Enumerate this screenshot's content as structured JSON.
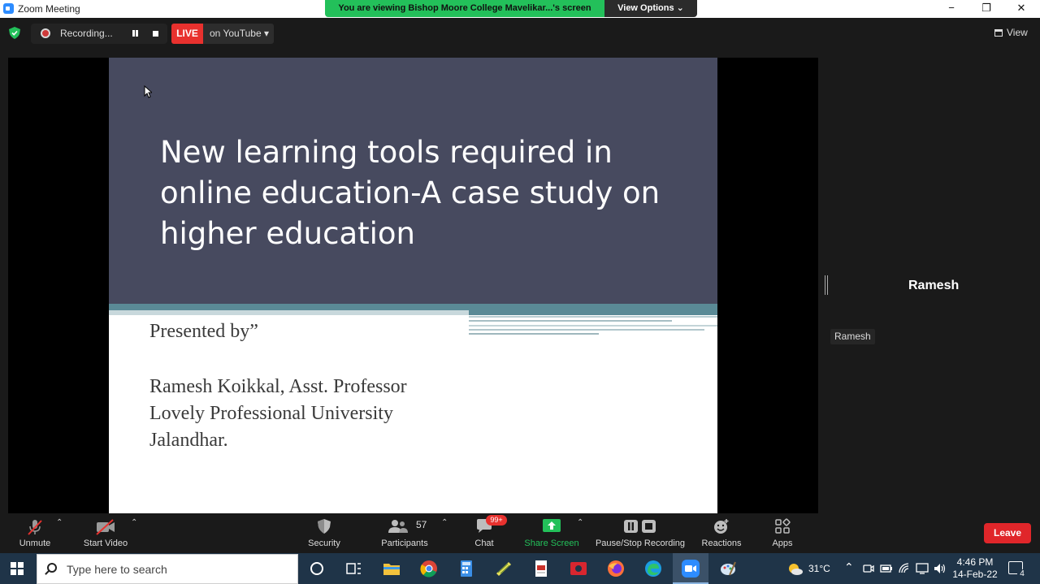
{
  "window": {
    "title": "Zoom Meeting",
    "minimize": "−",
    "restore": "❐",
    "close": "✕"
  },
  "share_banner": {
    "text": "You are viewing Bishop Moore College Mavelikar...'s screen",
    "view_options": "View Options ⌄"
  },
  "topbar": {
    "recording_label": "Recording...",
    "live_label": "LIVE",
    "live_target": "on YouTube ▾",
    "view_label": "View"
  },
  "slide": {
    "title": "New learning tools required in online education-A case study on higher education",
    "presented_by": "Presented by”",
    "author_lines": [
      "Ramesh Koikkal, Asst. Professor",
      "Lovely Professional University",
      "Jalandhar."
    ]
  },
  "participant": {
    "name": "Ramesh",
    "tag": "Ramesh"
  },
  "toolbar": {
    "unmute": "Unmute",
    "start_video": "Start Video",
    "security": "Security",
    "participants": "Participants",
    "participants_count": "57",
    "chat": "Chat",
    "chat_badge": "99+",
    "share_screen": "Share Screen",
    "pause_stop_recording": "Pause/Stop Recording",
    "reactions": "Reactions",
    "apps": "Apps",
    "leave": "Leave"
  },
  "taskbar": {
    "search_placeholder": "Type here to search",
    "weather": "31°C",
    "time": "4:46 PM",
    "date": "14-Feb-22",
    "notification_count": "4"
  },
  "colors": {
    "share_banner": "#23c05a",
    "live_badge": "#e8312e",
    "leave_button": "#e0262a",
    "slide_header": "#474a5f",
    "slide_band": "#5a8a96",
    "share_screen_icon": "#23c05a",
    "taskbar": "#1f3448"
  }
}
